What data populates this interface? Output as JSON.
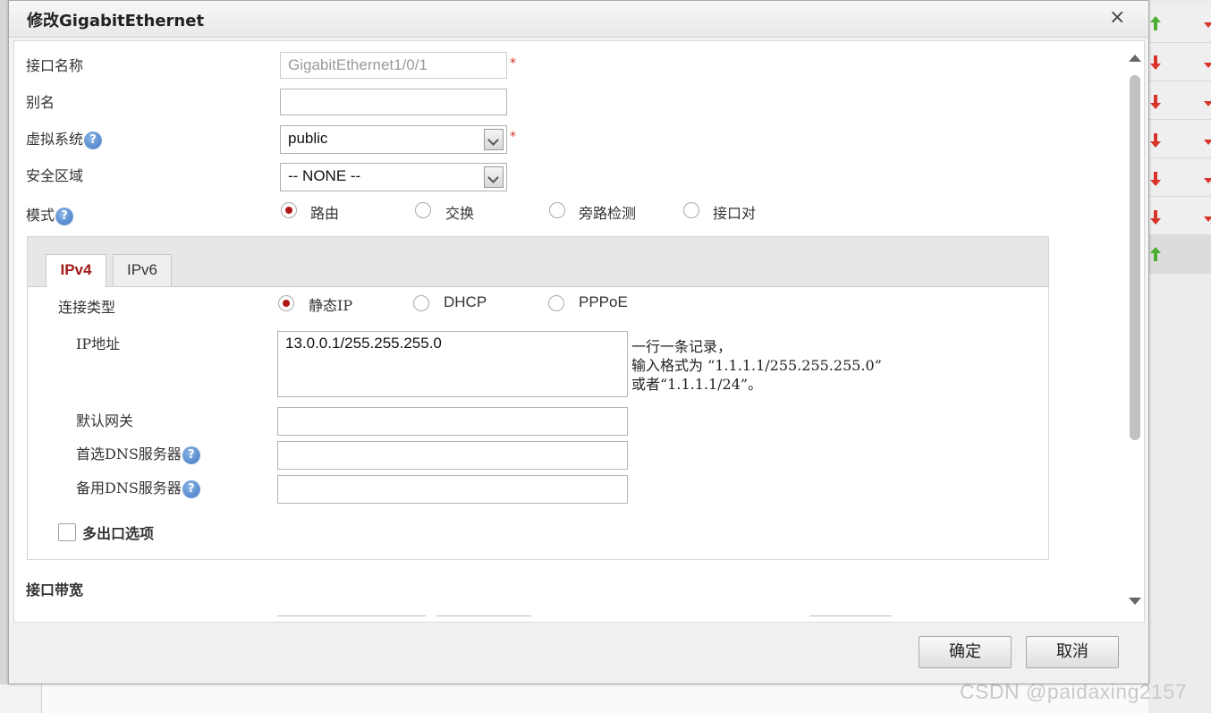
{
  "dialog": {
    "title": "修改GigabitEthernet",
    "close": "×"
  },
  "form": {
    "interface_name": {
      "label": "接口名称",
      "value": "GigabitEthernet1/0/1",
      "required_mark": "*"
    },
    "alias": {
      "label": "别名",
      "value": ""
    },
    "vsys": {
      "label": "虚拟系统",
      "value": "public",
      "required_mark": "*"
    },
    "zone": {
      "label": "安全区域",
      "value": "-- NONE --"
    },
    "mode": {
      "label": "模式",
      "options": [
        "路由",
        "交换",
        "旁路检测",
        "接口对"
      ],
      "selected": "路由"
    }
  },
  "tabs": {
    "ipv4": "IPv4",
    "ipv6": "IPv6",
    "active": "IPv4"
  },
  "ipv4": {
    "conn_type": {
      "label": "连接类型",
      "options": [
        "静态IP",
        "DHCP",
        "PPPoE"
      ],
      "selected": "静态IP"
    },
    "ip": {
      "label": "IP地址",
      "value": "13.0.0.1/255.255.255.0",
      "hint_lines": [
        "一行一条记录，",
        "输入格式为 “1.1.1.1/255.255.255.0”",
        "或者“1.1.1.1/24”。"
      ]
    },
    "gateway": {
      "label": "默认网关",
      "value": ""
    },
    "dns1": {
      "label": "首选DNS服务器",
      "value": ""
    },
    "dns2": {
      "label": "备用DNS服务器",
      "value": ""
    },
    "multi_exit": {
      "label": "多出口选项",
      "checked": false
    }
  },
  "bandwidth": {
    "label": "接口带宽"
  },
  "help_icon": "?",
  "buttons": {
    "ok": "确定",
    "cancel": "取消"
  },
  "background": {
    "watermark": "CSDN @paidaxing2157",
    "row_arrows": [
      "up",
      "down",
      "down",
      "down",
      "down",
      "down",
      "up"
    ]
  },
  "colors": {
    "accent_red": "#b01818",
    "required": "#e03030",
    "help_icon": "#3c74c4",
    "arrow_up": "#4caf32",
    "arrow_down": "#d9342b"
  }
}
